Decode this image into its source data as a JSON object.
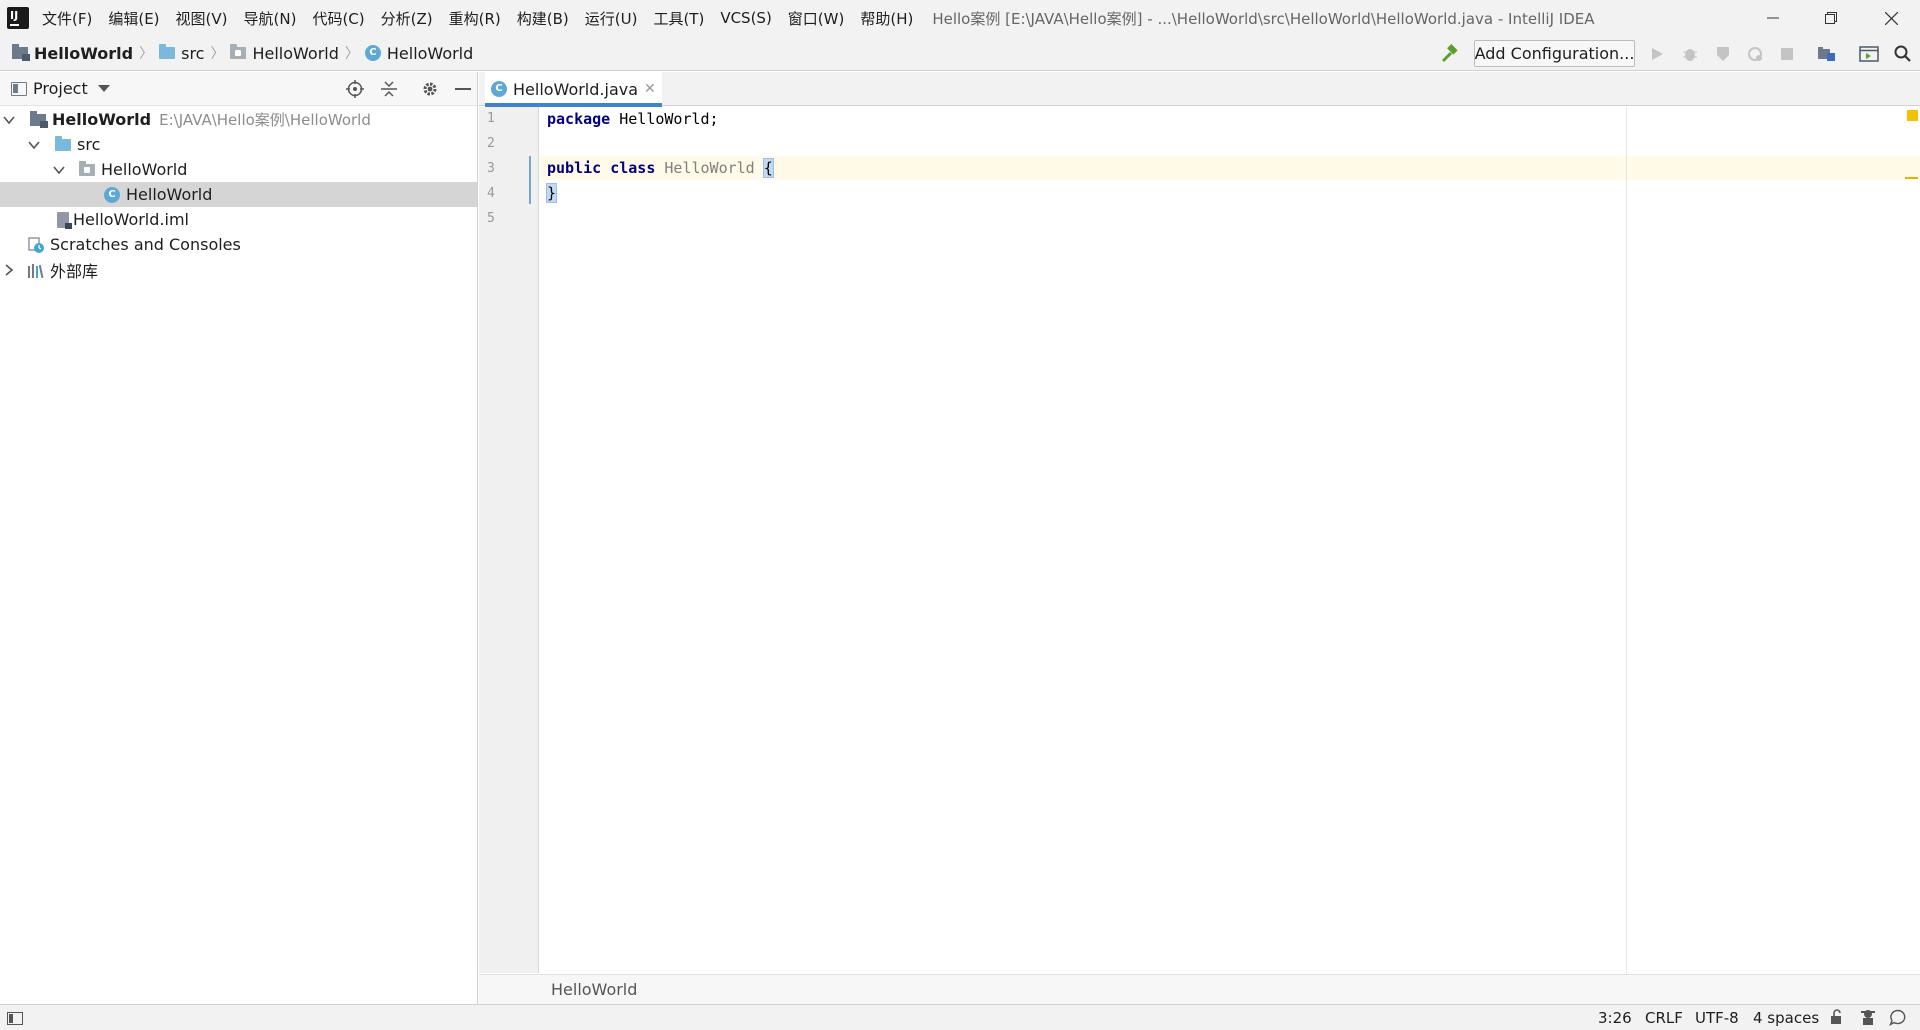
{
  "titlebar": {
    "menus": [
      "文件(F)",
      "编辑(E)",
      "视图(V)",
      "导航(N)",
      "代码(C)",
      "分析(Z)",
      "重构(R)",
      "构建(B)",
      "运行(U)",
      "工具(T)",
      "VCS(S)",
      "窗口(W)",
      "帮助(H)"
    ],
    "window_title": "Hello案例 [E:\\JAVA\\Hello案例] - ...\\HelloWorld\\src\\HelloWorld\\HelloWorld.java - IntelliJ IDEA",
    "logo_text": "IJ"
  },
  "navbar": {
    "crumbs": [
      "HelloWorld",
      "src",
      "HelloWorld",
      "HelloWorld"
    ],
    "add_configuration": "Add Configuration..."
  },
  "project": {
    "title": "Project",
    "tree": {
      "root_name": "HelloWorld",
      "root_path": "E:\\JAVA\\Hello案例\\HelloWorld",
      "src": "src",
      "package": "HelloWorld",
      "class": "HelloWorld",
      "iml": "HelloWorld.iml",
      "scratches": "Scratches and Consoles",
      "libraries": "外部库"
    }
  },
  "editor": {
    "tab_label": "HelloWorld.java",
    "class_icon_letter": "C",
    "line_numbers": [
      "1",
      "2",
      "3",
      "4",
      "5"
    ],
    "code": {
      "l1_kw": "package",
      "l1_rest": " HelloWorld;",
      "l3_kw1": "public",
      "l3_kw2": "class",
      "l3_name": "HelloWorld",
      "l3_brace": "{",
      "l4_brace": "}"
    },
    "breadcrumb": "HelloWorld"
  },
  "statusbar": {
    "position": "3:26",
    "line_sep": "CRLF",
    "encoding": "UTF-8",
    "indent": "4 spaces"
  },
  "colors": {
    "accent": "#4083c9",
    "keyword": "#000080",
    "caret_line": "#fffbe8",
    "selection": "#d5d5d5"
  }
}
